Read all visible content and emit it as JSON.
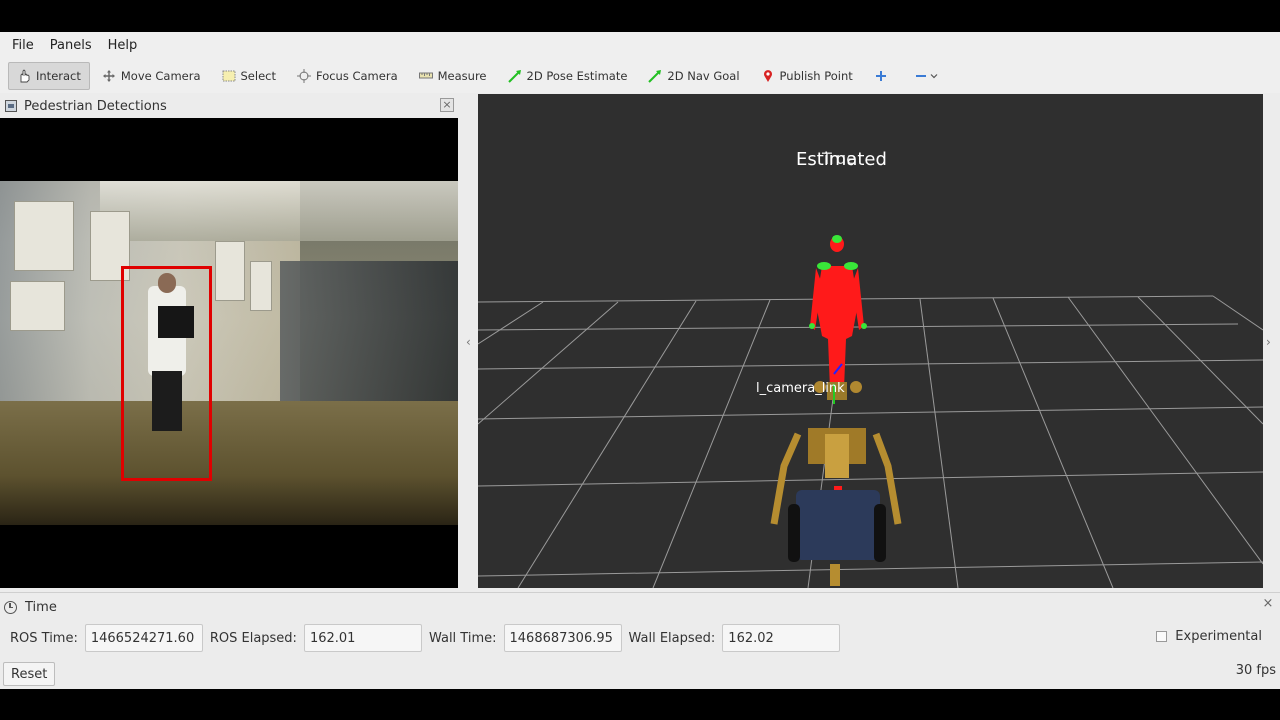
{
  "menu": {
    "file": "File",
    "panels": "Panels",
    "help": "Help"
  },
  "toolbar": {
    "interact": "Interact",
    "move_camera": "Move Camera",
    "select": "Select",
    "focus_camera": "Focus Camera",
    "measure": "Measure",
    "pose_estimate": "2D Pose Estimate",
    "nav_goal": "2D Nav Goal",
    "publish_point": "Publish Point",
    "active_tool": "Interact"
  },
  "image_panel": {
    "title": "Pedestrian Detections"
  },
  "view3d": {
    "label_estimated": "Estimated",
    "label_true": "True",
    "label_link": "l_camera_link",
    "background_color": "#2f2f2f",
    "grid_color": "#a0a0a0",
    "pedestrian_color": "#ff1a1a",
    "highlight_color": "#39e639"
  },
  "time_panel": {
    "title": "Time",
    "ros_time_label": "ROS Time:",
    "ros_time_value": "1466524271.60",
    "ros_elapsed_label": "ROS Elapsed:",
    "ros_elapsed_value": "162.01",
    "wall_time_label": "Wall Time:",
    "wall_time_value": "1468687306.95",
    "wall_elapsed_label": "Wall Elapsed:",
    "wall_elapsed_value": "162.02",
    "experimental_label": "Experimental",
    "experimental_checked": false,
    "reset_label": "Reset",
    "fps": "30 fps"
  }
}
